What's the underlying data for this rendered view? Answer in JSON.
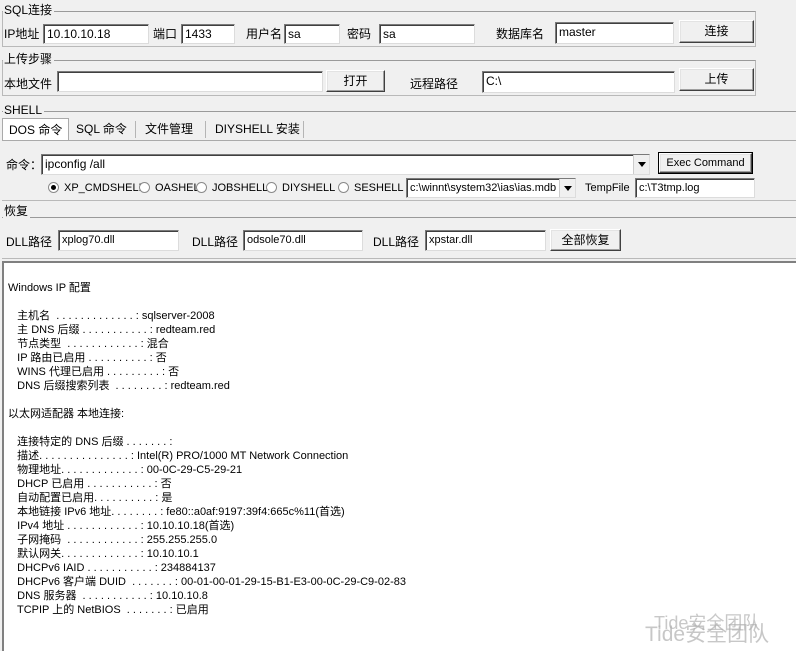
{
  "sql": {
    "title": "SQL连接",
    "ip_label": "IP地址",
    "ip_value": "10.10.10.18",
    "port_label": "端口",
    "port_value": "1433",
    "user_label": "用户名",
    "user_value": "sa",
    "pass_label": "密码",
    "pass_value": "sa",
    "db_label": "数据库名",
    "db_value": "master",
    "connect_label": "连接"
  },
  "upload": {
    "title": "上传步骤",
    "local_label": "本地文件",
    "local_value": "",
    "open_label": "打开",
    "remote_label": "远程路径",
    "remote_value": "C:\\",
    "upload_label": "上传"
  },
  "shell": {
    "title": "SHELL",
    "tabs": [
      "DOS 命令",
      "SQL 命令",
      "文件管理",
      "DIYSHELL 安装"
    ],
    "cmd_label": "命令：",
    "cmd_value": "ipconfig /all",
    "exec_label": "Exec Command",
    "radios": [
      "XP_CMDSHELL",
      "OASHEL",
      "JOBSHELL",
      "DIYSHELL",
      "SESHELL"
    ],
    "mdb_value": "c:\\winnt\\system32\\ias\\ias.mdb",
    "tempfile_label": "TempFile",
    "tempfile_value": "c:\\T3tmp.log"
  },
  "restore": {
    "title": "恢复",
    "dll1_label": "DLL路径",
    "dll1_value": "xplog70.dll",
    "dll2_label": "DLL路径",
    "dll2_value": "odsole70.dll",
    "dll3_label": "DLL路径",
    "dll3_value": "xpstar.dll",
    "restore_all_label": "全部恢复"
  },
  "output": {
    "lines": [
      "Windows IP 配置",
      "",
      "   主机名  . . . . . . . . . . . . . : sqlserver-2008",
      "   主 DNS 后缀 . . . . . . . . . . . : redteam.red",
      "   节点类型  . . . . . . . . . . . . : 混合",
      "   IP 路由已启用 . . . . . . . . . . : 否",
      "   WINS 代理已启用 . . . . . . . . . : 否",
      "   DNS 后缀搜索列表  . . . . . . . . : redteam.red",
      "",
      "以太网适配器 本地连接:",
      "",
      "   连接特定的 DNS 后缀 . . . . . . . :",
      "   描述. . . . . . . . . . . . . . . : Intel(R) PRO/1000 MT Network Connection",
      "   物理地址. . . . . . . . . . . . . : 00-0C-29-C5-29-21",
      "   DHCP 已启用 . . . . . . . . . . . : 否",
      "   自动配置已启用. . . . . . . . . . : 是",
      "   本地链接 IPv6 地址. . . . . . . . : fe80::a0af:9197:39f4:665c%11(首选)",
      "   IPv4 地址 . . . . . . . . . . . . : 10.10.10.18(首选)",
      "   子网掩码  . . . . . . . . . . . . : 255.255.255.0",
      "   默认网关. . . . . . . . . . . . . : 10.10.10.1",
      "   DHCPv6 IAID . . . . . . . . . . . : 234884137",
      "   DHCPv6 客户端 DUID  . . . . . . . : 00-01-00-01-29-15-B1-E3-00-0C-29-C9-02-83",
      "   DNS 服务器  . . . . . . . . . . . : 10.10.10.8",
      "   TCPIP 上的 NetBIOS  . . . . . . . : 已启用"
    ]
  },
  "watermark": {
    "text": "Tide安全团队"
  }
}
